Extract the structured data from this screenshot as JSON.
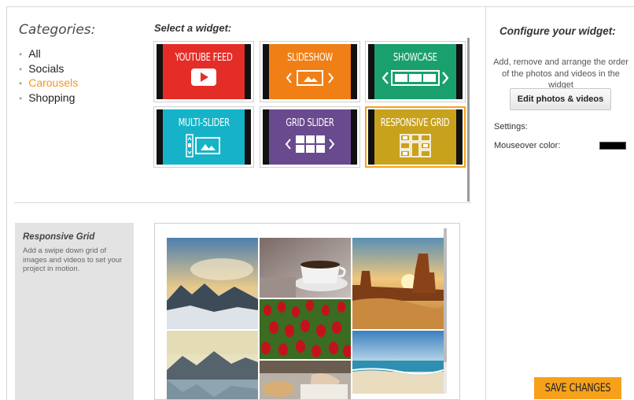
{
  "categories": {
    "title": "Categories:",
    "items": [
      {
        "label": "All",
        "active": false
      },
      {
        "label": "Socials",
        "active": false
      },
      {
        "label": "Carousels",
        "active": true
      },
      {
        "label": "Shopping",
        "active": false
      }
    ]
  },
  "widgets": {
    "title": "Select a widget:",
    "tiles": [
      {
        "label": "YOUTUBE FEED",
        "color": "#e52d27",
        "icon": "play-icon"
      },
      {
        "label": "SLIDESHOW",
        "color": "#f07f16",
        "icon": "slideshow-icon"
      },
      {
        "label": "SHOWCASE",
        "color": "#1aa06d",
        "icon": "showcase-icon"
      },
      {
        "label": "MULTI-SLIDER",
        "color": "#16b3c8",
        "icon": "multi-slider-icon"
      },
      {
        "label": "GRID SLIDER",
        "color": "#6a4a8e",
        "icon": "grid-slider-icon"
      },
      {
        "label": "RESPONSIVE GRID",
        "color": "#c9a21d",
        "icon": "responsive-grid-icon",
        "selected": true
      }
    ]
  },
  "config": {
    "title": "Configure your widget:",
    "description": "Add, remove and arrange the order of the photos and videos in the widget",
    "edit_button": "Edit photos & videos",
    "settings_label": "Settings:",
    "mouseover_label": "Mouseover color:",
    "mouseover_color": "#000000"
  },
  "info": {
    "title": "Responsive Grid",
    "description": "Add a swipe down grid of images and videos to set your project in motion."
  },
  "save_button": "SAVE CHANGES"
}
